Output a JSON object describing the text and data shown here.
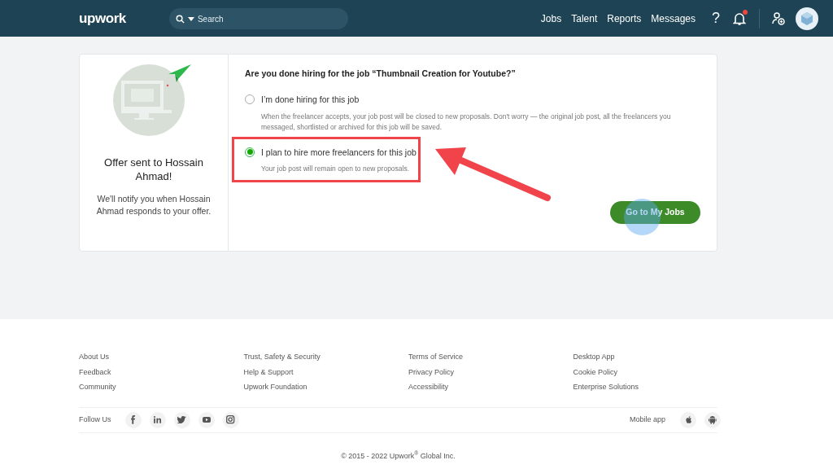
{
  "header": {
    "logo": "upwork",
    "search": {
      "placeholder": "Search"
    },
    "nav": [
      "Jobs",
      "Talent",
      "Reports",
      "Messages"
    ],
    "help": "?",
    "notification_dot": true
  },
  "offer": {
    "title": "Offer sent to Hossain Ahmad!",
    "message": "We'll notify you when Hossain Ahmad responds to your offer."
  },
  "question": "Are you done hiring for the job “Thumbnail Creation for Youtube?”",
  "options": [
    {
      "label": "I’m done hiring for this job",
      "description": "When the freelancer accepts, your job post will be closed to new proposals. Don't worry — the original job post, all the freelancers you messaged, shortlisted or archived for this job will be saved.",
      "selected": false
    },
    {
      "label": "I plan to hire more freelancers for this job",
      "description": "Your job post will remain open to new proposals.",
      "selected": true
    }
  ],
  "button": "Go to My Jobs",
  "footer": {
    "columns": [
      [
        "About Us",
        "Feedback",
        "Community"
      ],
      [
        "Trust, Safety & Security",
        "Help & Support",
        "Upwork Foundation"
      ],
      [
        "Terms of Service",
        "Privacy Policy",
        "Accessibility"
      ],
      [
        "Desktop App",
        "Cookie Policy",
        "Enterprise Solutions"
      ]
    ],
    "follow": "Follow Us",
    "mobile": "Mobile app",
    "copyright": "© 2015 - 2022 Upwork$^{®}$ Global Inc."
  }
}
